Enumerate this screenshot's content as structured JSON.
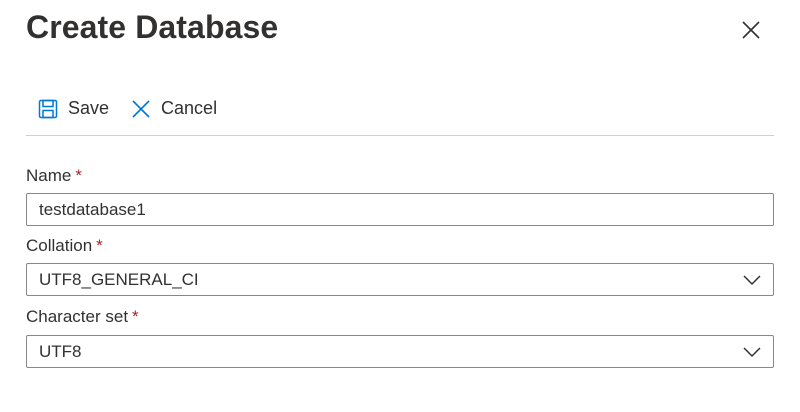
{
  "dialog": {
    "title": "Create Database",
    "close_icon": "close-icon"
  },
  "toolbar": {
    "save_label": "Save",
    "save_icon": "save-icon",
    "cancel_label": "Cancel",
    "cancel_icon": "cancel-icon"
  },
  "form": {
    "name": {
      "label": "Name",
      "required_mark": "*",
      "value": "testdatabase1"
    },
    "collation": {
      "label": "Collation",
      "required_mark": "*",
      "selected": "UTF8_GENERAL_CI"
    },
    "charset": {
      "label": "Character set",
      "required_mark": "*",
      "selected": "UTF8"
    }
  },
  "colors": {
    "accent": "#0078d4",
    "required": "#a4262c",
    "text": "#323130",
    "border": "#8a8886",
    "divider": "#d0d0d0"
  }
}
